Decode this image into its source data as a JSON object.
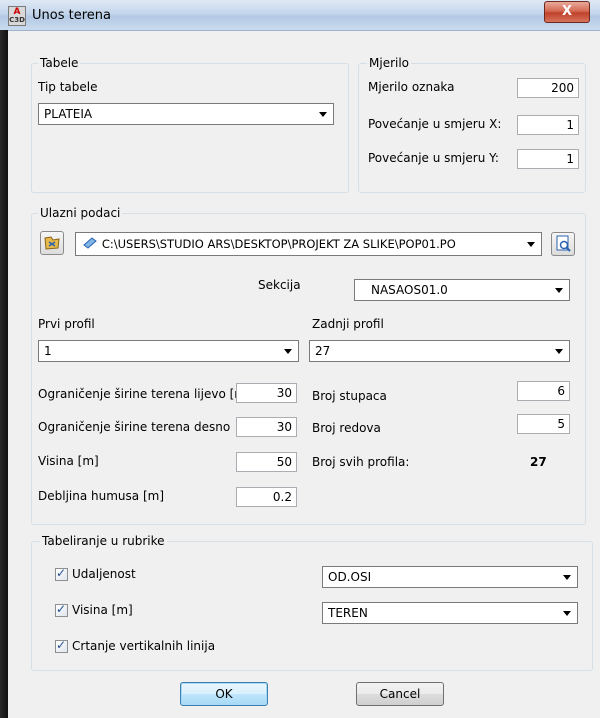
{
  "window": {
    "title": "Unos terena",
    "app_icon_letter": "A",
    "app_icon_sub": "C3D",
    "close_glyph": "X"
  },
  "tabele": {
    "legend": "Tabele",
    "tip_label": "Tip tabele",
    "tip_value": "PLATEIA"
  },
  "mjerilo": {
    "legend": "Mjerilo",
    "oznaka_label": "Mjerilo oznaka",
    "oznaka_value": "200",
    "x_label": "Povećanje u smjeru X:",
    "x_value": "1",
    "y_label": "Povećanje u smjeru Y:",
    "y_value": "1"
  },
  "ulazni": {
    "legend": "Ulazni podaci",
    "path_value": "C:\\USERS\\STUDIO ARS\\DESKTOP\\PROJEKT ZA SLIKE\\POP01.PO",
    "sekcija_label": "Sekcija",
    "sekcija_value": "NASAOS01.0",
    "prvi_label": "Prvi profil",
    "prvi_value": "1",
    "zadnji_label": "Zadnji profil",
    "zadnji_value": "27",
    "lijevo_label": "Ograničenje širine terena lijevo [m]",
    "lijevo_value": "30",
    "desno_label": "Ograničenje širine terena desno",
    "desno_value": "30",
    "visina_label": "Visina [m]",
    "visina_value": "50",
    "humus_label": "Debljina humusa [m]",
    "humus_value": "0.2",
    "stupaca_label": "Broj stupaca",
    "stupaca_value": "6",
    "redova_label": "Broj redova",
    "redova_value": "5",
    "svih_label": "Broj svih profila:",
    "svih_value": "27"
  },
  "rubrike": {
    "legend": "Tabeliranje u rubrike",
    "udaljenost_label": "Udaljenost",
    "udaljenost_value": "OD.OSI",
    "visina_label": "Visina [m]",
    "visina_value": "TEREN",
    "vertikalne_label": "Crtanje vertikalnih linija"
  },
  "buttons": {
    "ok": "OK",
    "cancel": "Cancel"
  },
  "icons": {
    "browse": "folder-browse-icon",
    "file": "file-icon",
    "preview": "preview-icon"
  }
}
